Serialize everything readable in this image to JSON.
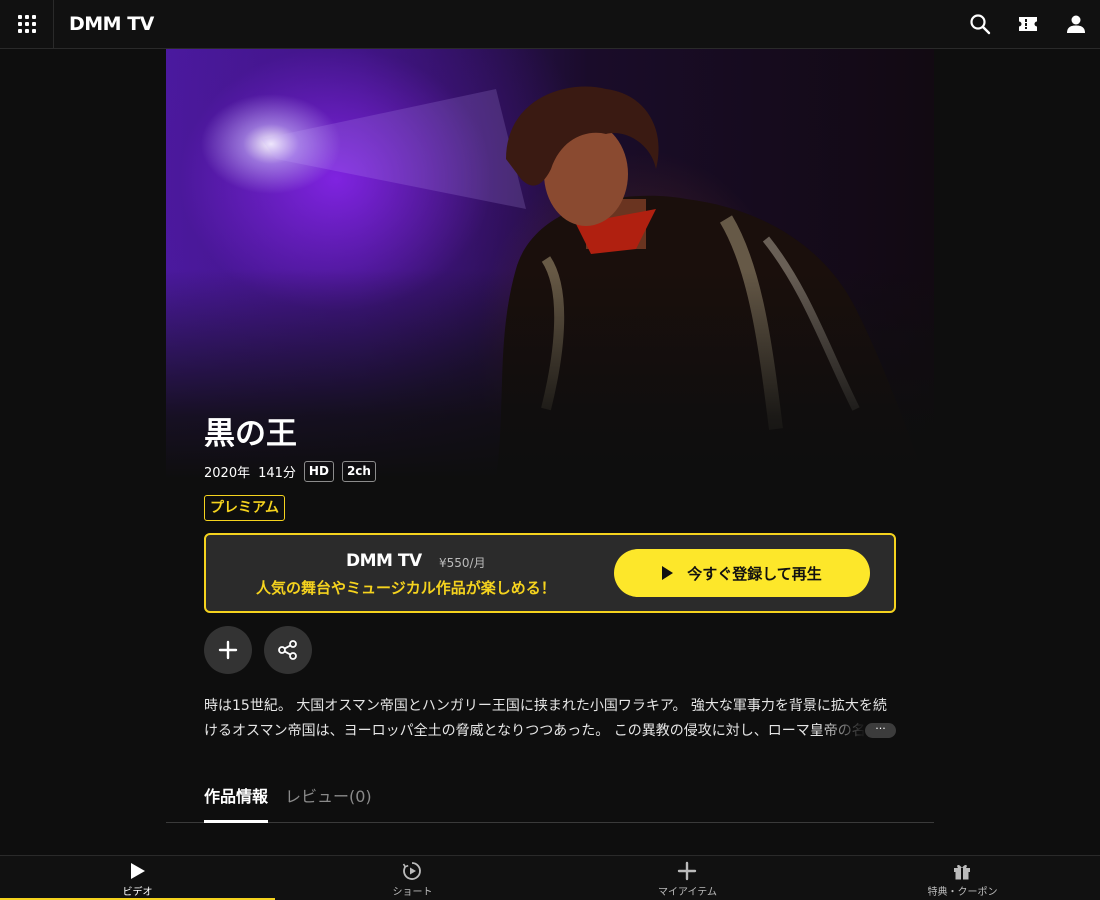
{
  "header": {
    "logo": "DMM TV",
    "icons": [
      "grid-menu-icon",
      "search-icon",
      "ticket-icon",
      "user-icon"
    ]
  },
  "work": {
    "title": "黒の王",
    "year": "2020年",
    "duration": "141分",
    "badges": [
      "HD",
      "2ch"
    ],
    "premium_label": "プレミアム"
  },
  "promo": {
    "logo": "DMM TV",
    "price": "¥550/月",
    "text": "人気の舞台やミュージカル作品が楽しめる！",
    "cta_label": "今すぐ登録して再生"
  },
  "actions": {
    "icons": [
      "plus-icon",
      "share-icon"
    ]
  },
  "description": {
    "text": "時は15世紀。 大国オスマン帝国とハンガリー王国に挟まれた小国ワラキア。 強大な軍事力を背景に拡大を続けるオスマン帝国は、ヨーロッパ全土の脅威となりつつあった。 この異教の侵攻に対し、ローマ皇帝の名",
    "more_label": "···"
  },
  "tabs": [
    {
      "label": "作品情報",
      "active": true
    },
    {
      "label": "レビュー(0)",
      "active": false
    }
  ],
  "bottom_nav": [
    {
      "label": "ビデオ",
      "icon": "play-icon",
      "active": true
    },
    {
      "label": "ショート",
      "icon": "short-video-icon",
      "active": false
    },
    {
      "label": "マイアイテム",
      "icon": "plus-icon",
      "active": false
    },
    {
      "label": "特典・クーポン",
      "icon": "gift-icon",
      "active": false
    }
  ],
  "colors": {
    "accent": "#f5d31e",
    "cta": "#fde72a",
    "background": "#0e0e0e"
  }
}
